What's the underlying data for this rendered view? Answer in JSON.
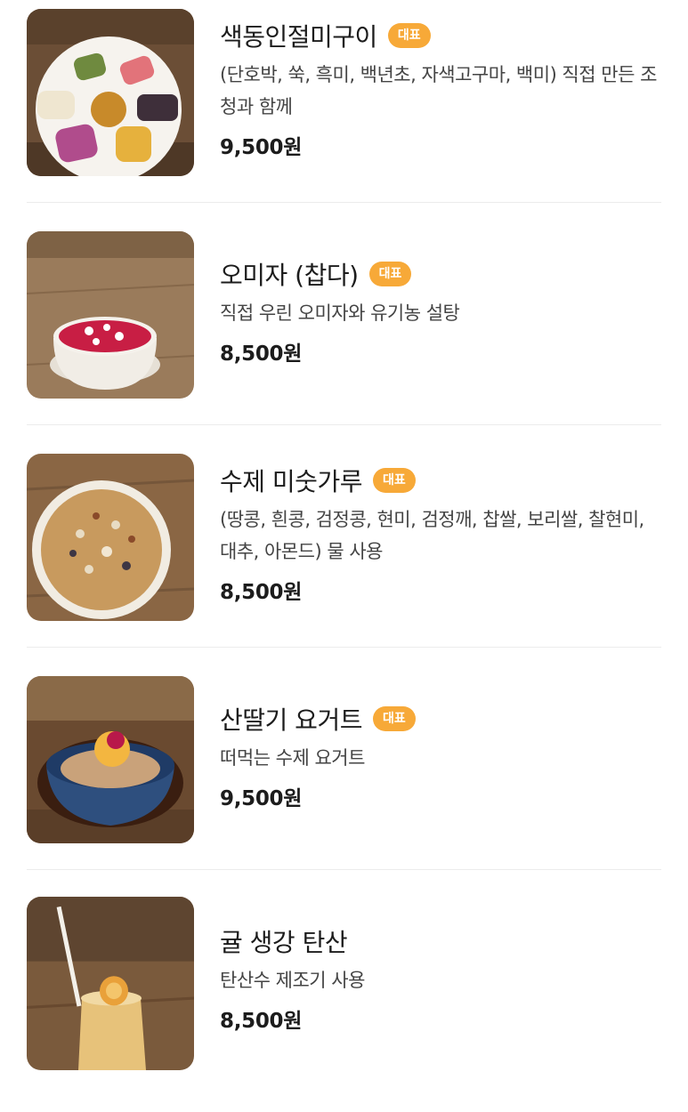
{
  "menu": {
    "items": [
      {
        "name": "색동인절미구이",
        "badge": "대표",
        "desc": "(단호박, 쑥, 흑미, 백년초, 자색고구마, 백미) 직접 만든 조청과 함께",
        "price": "9,500원",
        "image": "rice-cake-platter-photo"
      },
      {
        "name": "오미자 (찹다)",
        "badge": "대표",
        "desc": "직접 우린 오미자와 유기농 설탕",
        "price": "8,500원",
        "image": "omija-tea-bowl-photo"
      },
      {
        "name": "수제 미숫가루",
        "badge": "대표",
        "desc": "(땅콩, 흰콩, 검정콩, 현미, 검정깨, 찹쌀, 보리쌀, 찰현미, 대추, 아몬드) 물 사용",
        "price": "8,500원",
        "image": "misutgaru-bowl-photo"
      },
      {
        "name": "산딸기 요거트",
        "badge": "대표",
        "desc": "떠먹는 수제 요거트",
        "price": "9,500원",
        "image": "raspberry-yogurt-bowl-photo"
      },
      {
        "name": "귤 생강 탄산",
        "badge": "",
        "desc": "탄산수 제조기 사용",
        "price": "8,500원",
        "image": "tangerine-ginger-soda-photo"
      }
    ]
  },
  "colors": {
    "badge": "#f7a938",
    "divider": "#ececec",
    "wood": "#8a6a4a"
  }
}
